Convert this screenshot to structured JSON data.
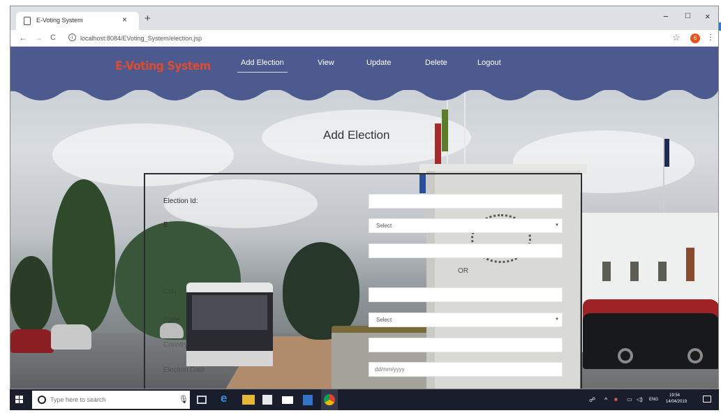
{
  "browser": {
    "tab_title": "E-Voting System",
    "tab_close": "×",
    "new_tab": "+",
    "url": "localhost:8084/EVoting_System/election.jsp",
    "profile_initial": "6",
    "controls": {
      "minimize": "−",
      "maximize": "☐",
      "close": "×"
    },
    "nav": {
      "back": "←",
      "forward": "→",
      "reload": "C"
    }
  },
  "site": {
    "brand": "E-Voting System",
    "nav": [
      "Add Election",
      "View",
      "Update",
      "Delete",
      "Logout"
    ],
    "active_nav": "Add Election",
    "header_color": "#4d5a8f",
    "brand_color": "#e04b2e"
  },
  "form": {
    "title": "Add Election",
    "labels": {
      "election_id": "Election Id:",
      "partial_1": "E",
      "partial_2": "Con",
      "partial_3": "State",
      "partial_4": "Country",
      "election_date": "Election Date"
    },
    "fields": {
      "select_1": "Select",
      "select_2": "Select",
      "date_placeholder": "dd/mm/yyyy"
    },
    "or_label": "OR"
  },
  "taskbar": {
    "search_placeholder": "Type here to search",
    "tray_lang": "ENG",
    "time": "19:54",
    "date": "14/04/2019"
  }
}
